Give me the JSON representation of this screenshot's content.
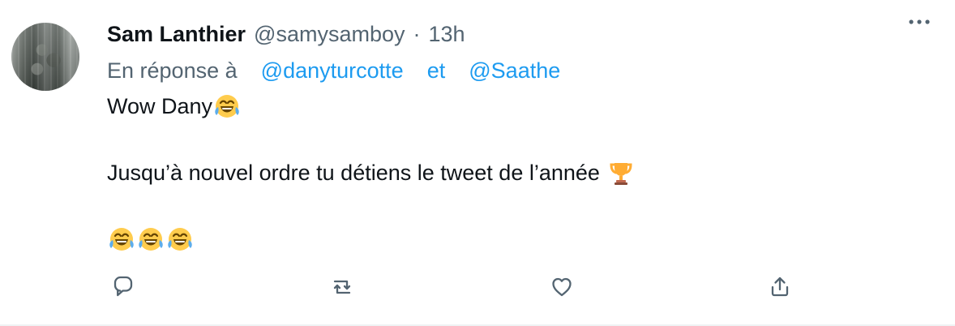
{
  "tweet": {
    "author_name": "Sam Lanthier",
    "author_handle": "@samysamboy",
    "separator": "·",
    "time": "13h",
    "reply_prefix": "En réponse à",
    "reply_users": [
      "@danyturcotte",
      "@Saathe"
    ],
    "reply_joiner": "et",
    "body_line_1": "Wow Dany",
    "body_line_2": "Jusqu’à nouvel ordre tu détiens le tweet de l’année",
    "emoji_line_3_count": 3,
    "icons": {
      "avatar": "profile-avatar",
      "more": "more-options-icon",
      "laugh": "laughing-tears-emoji-icon",
      "trophy": "trophy-emoji-icon",
      "reply": "reply-icon",
      "retweet": "retweet-icon",
      "like": "heart-icon",
      "share": "share-icon"
    }
  },
  "colors": {
    "primary_text": "#0f1419",
    "secondary_text": "#536471",
    "link": "#1d9bf0",
    "divider": "#eff3f4"
  }
}
